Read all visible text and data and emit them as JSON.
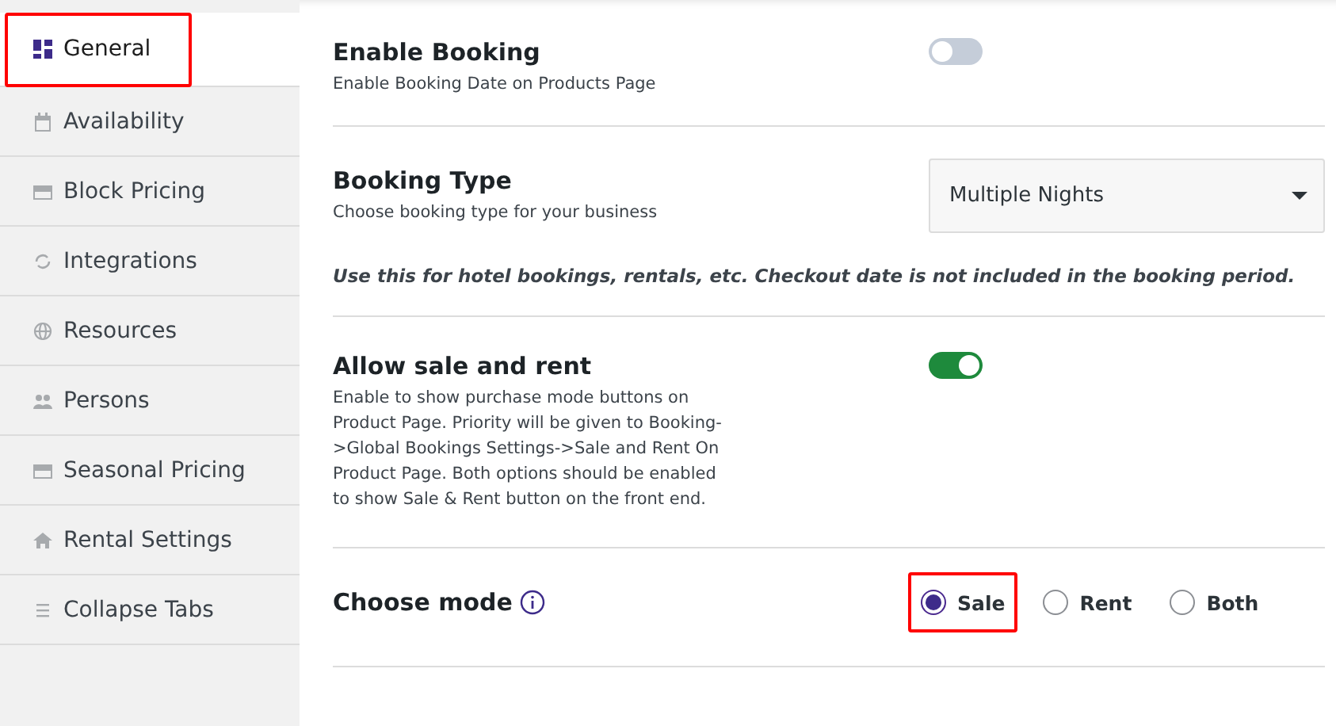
{
  "sidebar": {
    "items": [
      {
        "label": "General",
        "selected": true,
        "highlighted": true
      },
      {
        "label": "Availability",
        "selected": false,
        "highlighted": false
      },
      {
        "label": "Block Pricing",
        "selected": false,
        "highlighted": false
      },
      {
        "label": "Integrations",
        "selected": false,
        "highlighted": false
      },
      {
        "label": "Resources",
        "selected": false,
        "highlighted": false
      },
      {
        "label": "Persons",
        "selected": false,
        "highlighted": false
      },
      {
        "label": "Seasonal Pricing",
        "selected": false,
        "highlighted": false
      },
      {
        "label": "Rental Settings",
        "selected": false,
        "highlighted": false
      },
      {
        "label": "Collapse Tabs",
        "selected": false,
        "highlighted": false
      }
    ]
  },
  "settings": [
    {
      "kind": "toggle",
      "title": "Enable Booking",
      "description": "Enable Booking Date on Products Page",
      "on": false
    },
    {
      "kind": "select",
      "title": "Booking Type",
      "description": "Choose booking type for your business",
      "value": "Multiple Nights",
      "note": "Use this for hotel bookings, rentals, etc. Checkout date is not included in the booking period."
    },
    {
      "kind": "toggle",
      "title": "Allow sale and rent",
      "description": "Enable to show purchase mode buttons on Product Page. Priority will be given to Booking->Global Bookings Settings->Sale and Rent On Product Page. Both options should be enabled to show Sale & Rent button on the front end.",
      "on": true
    },
    {
      "kind": "radio",
      "title": "Choose mode",
      "info": true,
      "options": [
        {
          "label": "Sale",
          "selected": true,
          "highlighted": true
        },
        {
          "label": "Rent",
          "selected": false,
          "highlighted": false
        },
        {
          "label": "Both",
          "selected": false,
          "highlighted": false
        }
      ]
    }
  ]
}
